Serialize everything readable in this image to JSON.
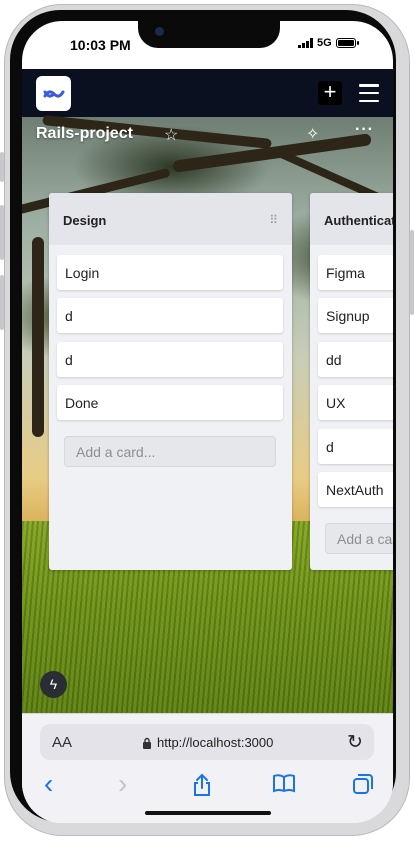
{
  "status_bar": {
    "time": "10:03 PM",
    "network": "5G"
  },
  "navbar": {
    "logo": "app-logo",
    "add_label": "+",
    "menu": "hamburger-icon"
  },
  "board": {
    "title": "Rails-project",
    "star_glyph": "☆",
    "sparkle_glyph": "✧",
    "more_glyph": "···"
  },
  "lists": [
    {
      "title": "Design",
      "drag_glyph": "⠿",
      "cards": [
        "Login",
        "d",
        "d",
        "Done"
      ],
      "add_card_placeholder": "Add a card..."
    },
    {
      "title": "Authentication",
      "cards": [
        "Figma",
        "Signup",
        "dd",
        "UX",
        "d",
        "NextAuth"
      ],
      "add_card_placeholder": "Add a card..."
    }
  ],
  "safari": {
    "text_size_label": "AA",
    "url": "http://localhost:3000",
    "lock_glyph": "🔒",
    "reload_glyph": "↻",
    "back_glyph": "‹",
    "forward_glyph": "›",
    "share_glyph": "⇪",
    "bookmarks_glyph": "📖",
    "tabs_glyph": "⧉"
  },
  "fab_glyph": "ϟ",
  "colors": {
    "navbar": "#0b1021",
    "list_background": "#f0f1f4",
    "accent_blue": "#1a73e8"
  }
}
